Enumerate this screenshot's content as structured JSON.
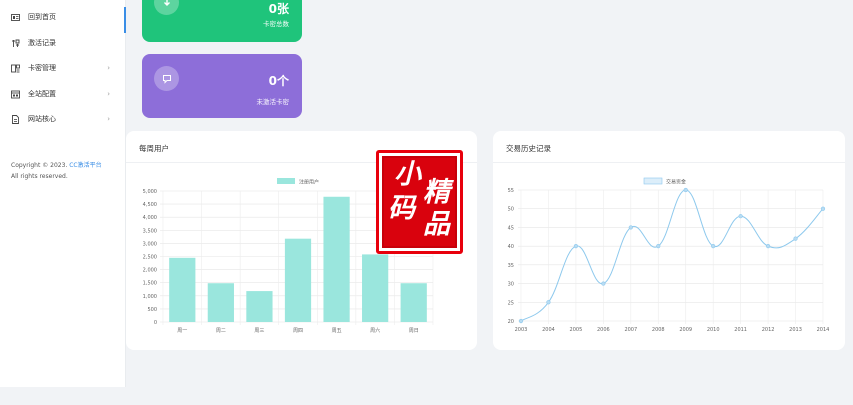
{
  "sidebar": {
    "items": [
      {
        "label": "回到首页",
        "icon": "home-icon",
        "active": true,
        "has_arrow": false
      },
      {
        "label": "激活记录",
        "icon": "history-icon",
        "active": false,
        "has_arrow": false
      },
      {
        "label": "卡密管理",
        "icon": "card-icon",
        "active": false,
        "has_arrow": true
      },
      {
        "label": "全站配置",
        "icon": "settings-icon",
        "active": false,
        "has_arrow": true
      },
      {
        "label": "网站核心",
        "icon": "document-icon",
        "active": false,
        "has_arrow": true
      }
    ],
    "copyright_prefix": "Copyright © 2023. ",
    "copyright_brand": "CC激活平台",
    "copyright_suffix": "All rights reserved.",
    "arrow": "›"
  },
  "stats": {
    "total_cards": {
      "value": "0张",
      "label": "卡密总数"
    },
    "inactive_cards": {
      "value": "0个",
      "label": "未激活卡密"
    }
  },
  "weekly_panel": {
    "title": "每周用户"
  },
  "history_panel": {
    "title": "交易历史记录"
  },
  "watermark": {
    "chars": [
      "小",
      "精",
      "码",
      "品"
    ]
  },
  "colors": {
    "accent": "#3a8ee6",
    "green": "#1fc47b",
    "purple": "#8d6ed9",
    "bar": "#9ae6dd",
    "line": "#8ec9ed"
  },
  "chart_data": [
    {
      "type": "bar",
      "categories": [
        "周一",
        "周二",
        "周三",
        "周四",
        "周五",
        "周六",
        "周日"
      ],
      "series": [
        {
          "name": "注册用户",
          "values": [
            2450,
            1480,
            1180,
            3180,
            4780,
            2580,
            1480
          ]
        }
      ],
      "ylim": [
        0,
        5000
      ],
      "yticks": [
        0,
        500,
        1000,
        1500,
        2000,
        2500,
        3000,
        3500,
        4000,
        4500,
        5000
      ],
      "legend": "top-center",
      "grid": true
    },
    {
      "type": "line",
      "x": [
        "2003",
        "2004",
        "2005",
        "2006",
        "2007",
        "2008",
        "2009",
        "2010",
        "2011",
        "2012",
        "2013",
        "2014"
      ],
      "series": [
        {
          "name": "交易资金",
          "values": [
            20,
            25,
            40,
            30,
            45,
            40,
            55,
            40,
            48,
            40,
            42,
            50
          ]
        }
      ],
      "ylim": [
        20,
        55
      ],
      "yticks": [
        20,
        25,
        30,
        35,
        40,
        45,
        50,
        55
      ],
      "legend": "top-center",
      "grid": true,
      "smooth": true
    }
  ]
}
